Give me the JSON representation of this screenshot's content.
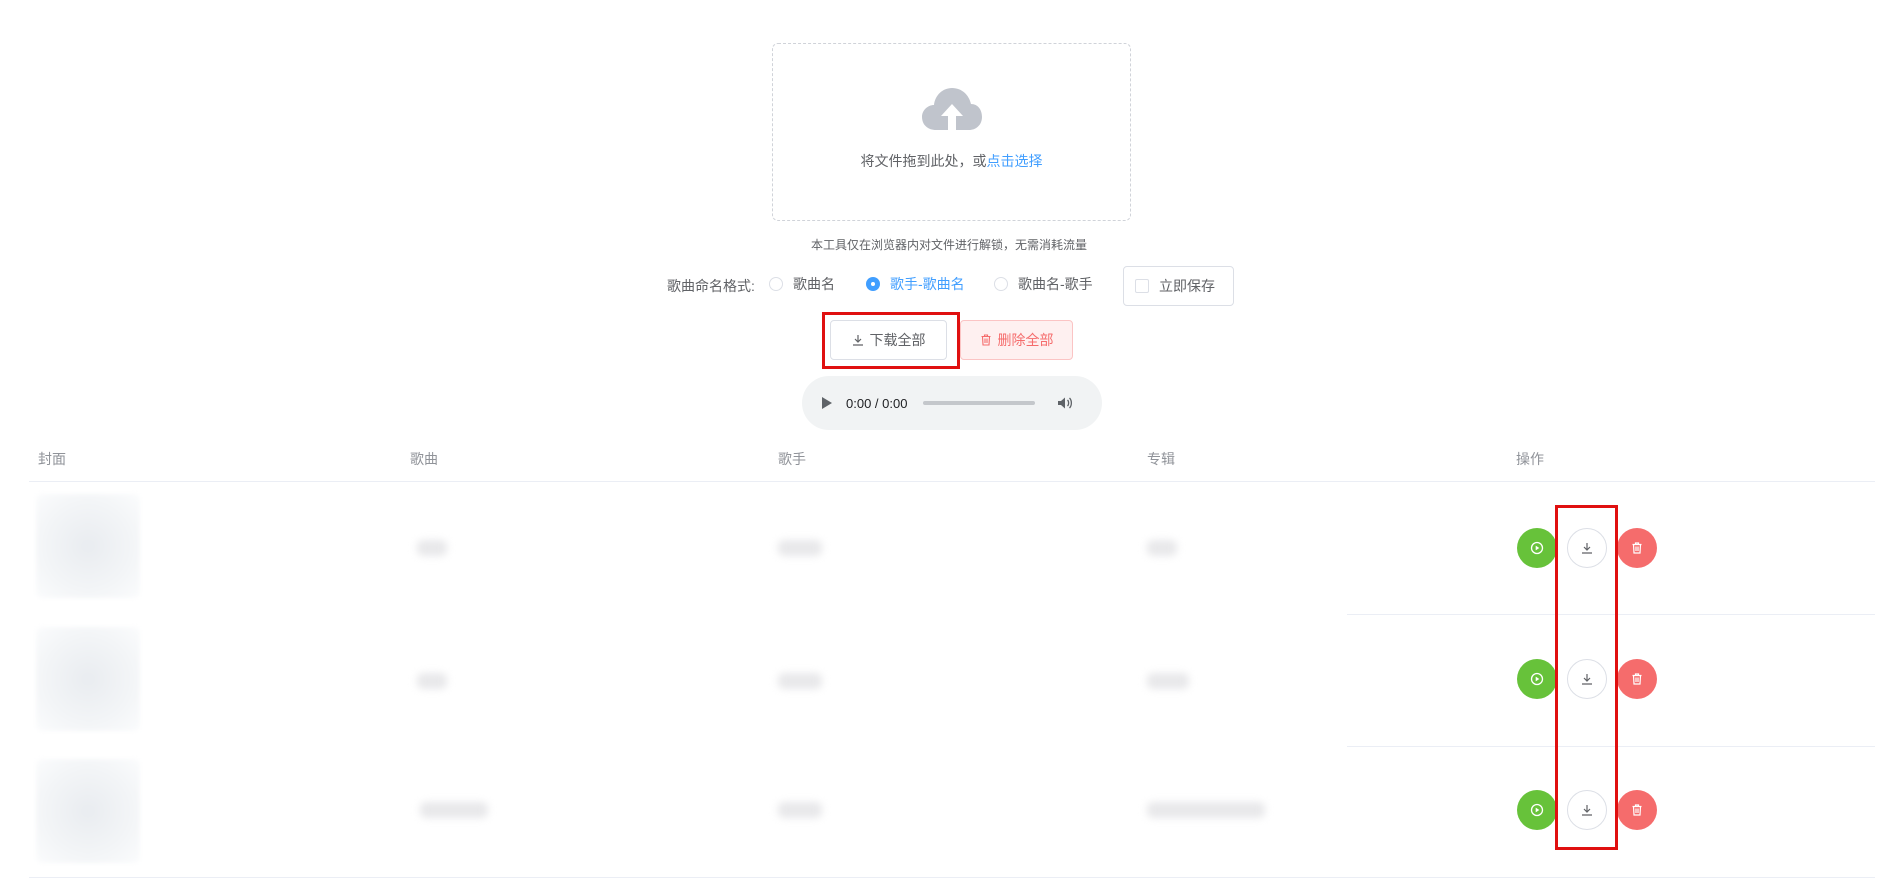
{
  "upload": {
    "drop_text": "将文件拖到此处，或",
    "click_text": "点击选择",
    "tip": "本工具仅在浏览器内对文件进行解锁，无需消耗流量"
  },
  "naming": {
    "label": "歌曲命名格式:",
    "options": [
      "歌曲名",
      "歌手-歌曲名",
      "歌曲名-歌手"
    ],
    "selected": "歌手-歌曲名",
    "save_now": "立即保存"
  },
  "actions": {
    "download_all": "下载全部",
    "delete_all": "删除全部"
  },
  "player": {
    "time": "0:00 / 0:00"
  },
  "table": {
    "headers": [
      "封面",
      "歌曲",
      "歌手",
      "专辑",
      "操作"
    ],
    "rows": [
      {
        "title": "",
        "artist": "",
        "album": ""
      },
      {
        "title": "",
        "artist": "",
        "album": ""
      },
      {
        "title": "",
        "artist": "",
        "album": ""
      }
    ]
  },
  "colors": {
    "primary": "#409eff",
    "success": "#67c23a",
    "danger": "#f56c6c",
    "highlight": "#e01010"
  }
}
